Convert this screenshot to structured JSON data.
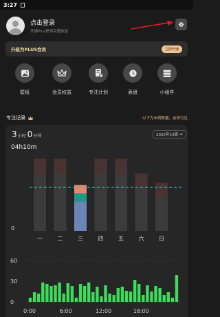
{
  "status_bar": {
    "time": "3:27"
  },
  "profile": {
    "title": "点击登录",
    "subtitle": "开通Plus获得完整体验"
  },
  "plus_banner": {
    "title": "升级为PLUS会员",
    "button": "立即开通"
  },
  "quick_actions": [
    {
      "label": "壁纸",
      "icon": "wallpaper-icon"
    },
    {
      "label": "会员权益",
      "icon": "crown-icon"
    },
    {
      "label": "专注计划",
      "icon": "plan-icon"
    },
    {
      "label": "表盘",
      "icon": "clock-icon"
    },
    {
      "label": "小组件",
      "icon": "widget-icon"
    }
  ],
  "records": {
    "title": "专注记录",
    "note": "以下为示例数据，会员可见",
    "duration_hours": "3",
    "hours_unit": "小时",
    "duration_minutes": "0",
    "minutes_unit": "分钟",
    "week_selector": "2022年10周",
    "average_label": "04h10m"
  },
  "colors": {
    "accent": "#2ec4b6",
    "green": "#3ddc5a",
    "gold": "#f0c79a"
  },
  "chart_data": [
    {
      "type": "bar",
      "categories": [
        "一",
        "二",
        "三",
        "四",
        "五",
        "六",
        "日"
      ],
      "total_hours": [
        6.9,
        6.9,
        4.4,
        6.9,
        6.9,
        5.5,
        4.6
      ],
      "highlighted_category": "三",
      "highlighted_segments": [
        {
          "color": "#e9866f",
          "from": 3.6,
          "to": 4.4
        },
        {
          "color": "#1f9a86",
          "from": 2.8,
          "to": 3.6
        },
        {
          "color": "#6b86b6",
          "from": 0,
          "to": 2.8
        }
      ],
      "average_hours": 4.17,
      "ylim": [
        0,
        7
      ],
      "ytick_labels": [
        "0"
      ]
    },
    {
      "type": "bar",
      "x_tick_labels": [
        "0:00",
        "6:00",
        "12:00",
        "18:00"
      ],
      "y_tick_labels": [
        "0",
        "30",
        "60"
      ],
      "ylim": [
        0,
        60
      ],
      "values": [
        6,
        14,
        12,
        28,
        26,
        23,
        24,
        28,
        12,
        27,
        23,
        6,
        26,
        23,
        28,
        14,
        22,
        8,
        24,
        12,
        10,
        20,
        22,
        16,
        15,
        32,
        26,
        10,
        24,
        15,
        23,
        20,
        10,
        14,
        6,
        39
      ]
    }
  ]
}
